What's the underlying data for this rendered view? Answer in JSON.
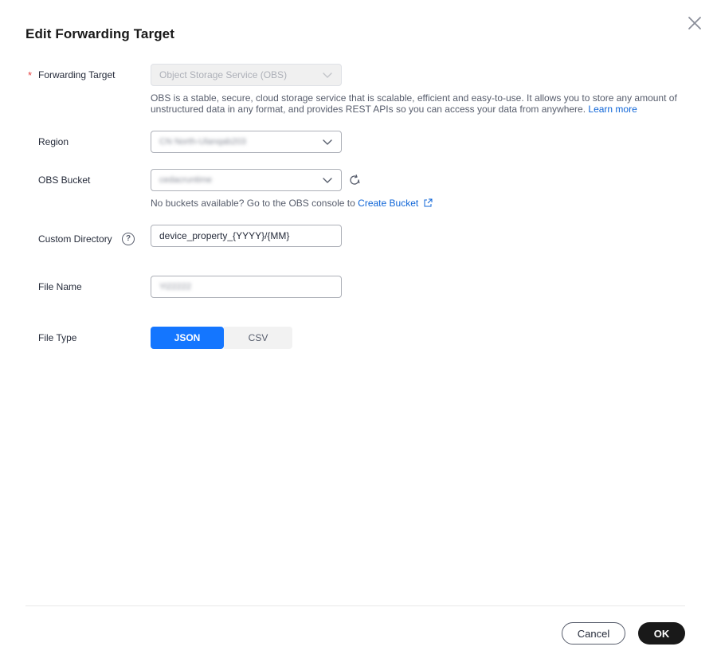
{
  "dialog": {
    "title": "Edit Forwarding Target"
  },
  "form": {
    "forwarding_target": {
      "required_mark": "*",
      "label": "Forwarding Target",
      "value": "Object Storage Service (OBS)",
      "description": "OBS is a stable, secure, cloud storage service that is scalable, efficient and easy-to-use. It allows you to store any amount of unstructured data in any format, and provides REST APIs so you can access your data from anywhere.",
      "learn_more": "Learn more"
    },
    "region": {
      "label": "Region",
      "value": "CN North-Ulanqab203"
    },
    "obs_bucket": {
      "label": "OBS Bucket",
      "value": "cedacruntime",
      "hint": "No buckets available? Go to the OBS console to",
      "create_link": "Create Bucket"
    },
    "custom_directory": {
      "label": "Custom Directory",
      "help": "?",
      "value": "device_property_{YYYY}/{MM}"
    },
    "file_name": {
      "label": "File Name",
      "value": "Yi22222"
    },
    "file_type": {
      "label": "File Type",
      "options": [
        "JSON",
        "CSV"
      ],
      "selected": "JSON"
    }
  },
  "footer": {
    "cancel_label": "Cancel",
    "ok_label": "OK"
  },
  "colors": {
    "accent": "#1476ff",
    "link": "#0d64d7",
    "required": "#e54545",
    "primary_button": "#191919"
  },
  "icons": {
    "close": "close-icon",
    "chevron": "chevron-down-icon",
    "refresh": "refresh-icon",
    "help": "help-icon",
    "external_link": "external-link-icon"
  }
}
